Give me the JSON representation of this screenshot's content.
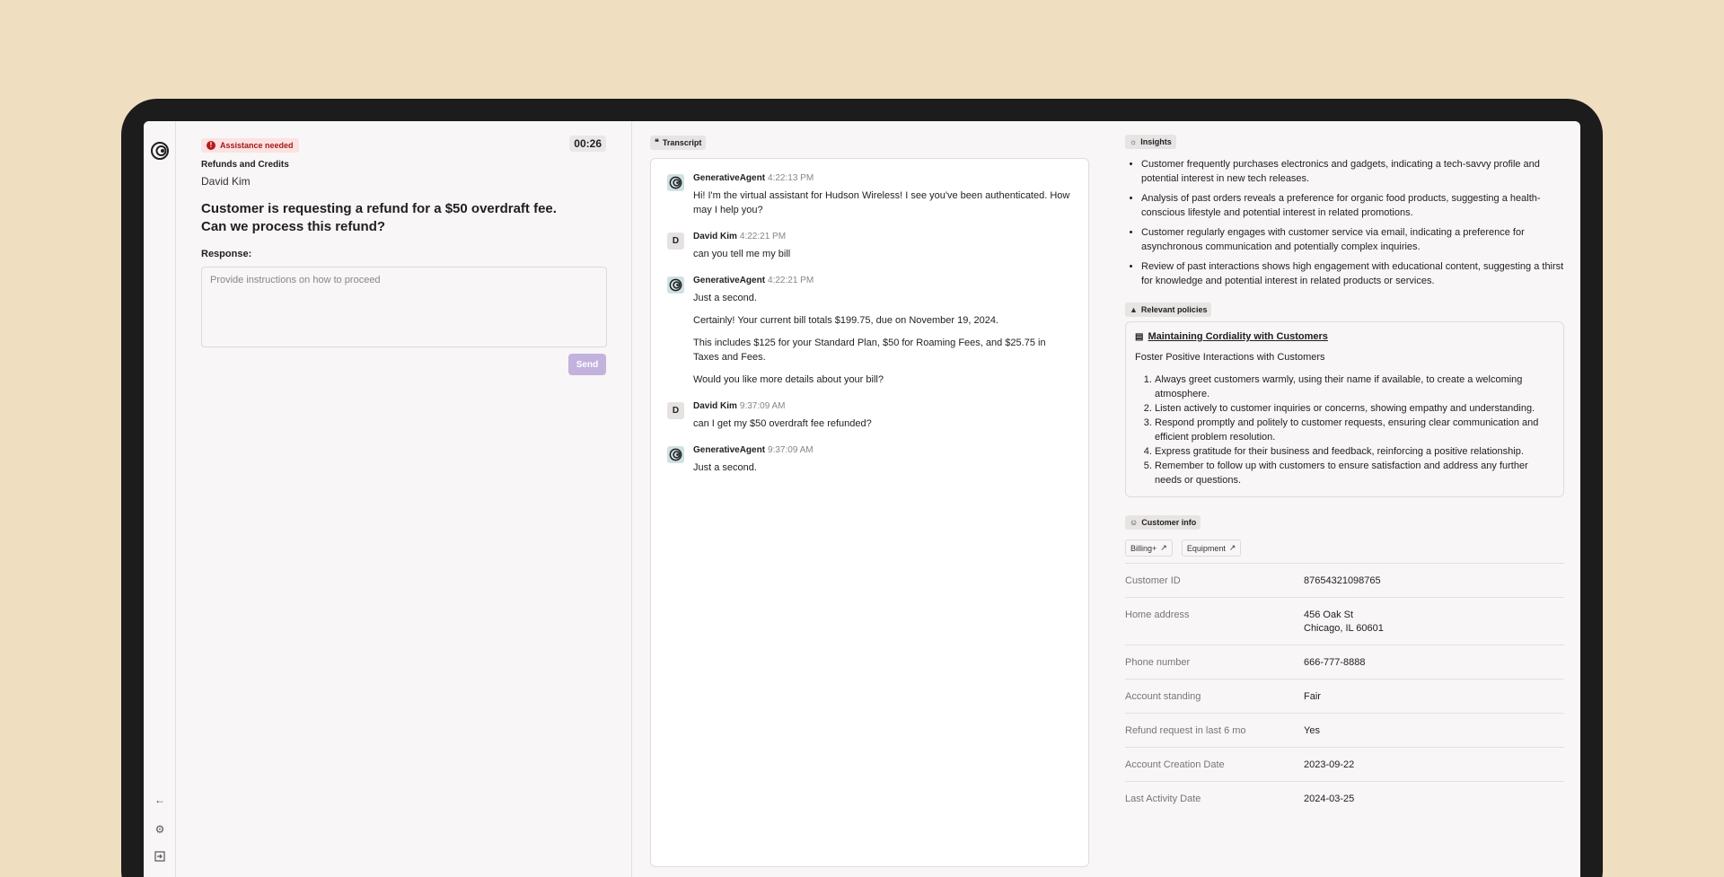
{
  "request": {
    "badge": "Assistance needed",
    "timer": "00:26",
    "category": "Refunds and Credits",
    "customer": "David Kim",
    "question": "Customer is requesting a refund for a $50 overdraft fee. Can we process this refund?",
    "response_label": "Response:",
    "response_placeholder": "Provide instructions on how to proceed",
    "send_label": "Send"
  },
  "transcript": {
    "title": "Transcript",
    "messages": [
      {
        "who": "GenerativeAgent",
        "time": "4:22:13 PM",
        "type": "agent",
        "texts": [
          "Hi! I'm the virtual assistant for Hudson Wireless! I see you've been authenticated. How may I help you?"
        ]
      },
      {
        "who": "David Kim",
        "time": "4:22:21 PM",
        "type": "user",
        "initial": "D",
        "texts": [
          "can you tell me my bill"
        ]
      },
      {
        "who": "GenerativeAgent",
        "time": "4:22:21 PM",
        "type": "agent",
        "texts": [
          "Just a second.",
          "Certainly! Your current bill totals $199.75, due on November 19, 2024.",
          "This includes $125 for your Standard Plan, $50 for Roaming Fees, and $25.75 in Taxes and Fees.",
          "Would you like more details about your bill?"
        ]
      },
      {
        "who": "David Kim",
        "time": "9:37:09 AM",
        "type": "user",
        "initial": "D",
        "texts": [
          "can I get my $50 overdraft fee refunded?"
        ]
      },
      {
        "who": "GenerativeAgent",
        "time": "9:37:09 AM",
        "type": "agent",
        "texts": [
          "Just a second."
        ]
      }
    ]
  },
  "insights": {
    "title": "Insights",
    "items": [
      "Customer frequently purchases electronics and gadgets, indicating a tech-savvy profile and potential interest in new tech releases.",
      "Analysis of past orders reveals a preference for organic food products, suggesting a health-conscious lifestyle and potential interest in related promotions.",
      "Customer regularly engages with customer service via email, indicating a preference for asynchronous communication and potentially complex inquiries.",
      "Review of past interactions shows high engagement with educational content, suggesting a thirst for knowledge and potential interest in related products or services."
    ]
  },
  "policies": {
    "title": "Relevant policies",
    "policy_title": "Maintaining Cordiality with Customers",
    "policy_sub": "Foster Positive Interactions with Customers",
    "items": [
      "Always greet customers warmly, using their name if available, to create a welcoming atmosphere.",
      "Listen actively to customer inquiries or concerns, showing empathy and understanding.",
      "Respond promptly and politely to customer requests, ensuring clear communication and efficient problem resolution.",
      "Express gratitude for their business and feedback, reinforcing a positive relationship.",
      "Remember to follow up with customers to ensure satisfaction and address any further needs or questions."
    ]
  },
  "customer_info": {
    "title": "Customer info",
    "links": [
      "Billing+",
      "Equipment"
    ],
    "rows": [
      {
        "k": "Customer ID",
        "v": "87654321098765"
      },
      {
        "k": "Home address",
        "v": "456 Oak St",
        "v2": "Chicago, IL 60601"
      },
      {
        "k": "Phone number",
        "v": "666-777-8888"
      },
      {
        "k": "Account standing",
        "v": "Fair"
      },
      {
        "k": "Refund request in last 6 mo",
        "v": "Yes"
      },
      {
        "k": "Account Creation Date",
        "v": "2023-09-22"
      },
      {
        "k": "Last Activity Date",
        "v": "2024-03-25"
      }
    ]
  }
}
